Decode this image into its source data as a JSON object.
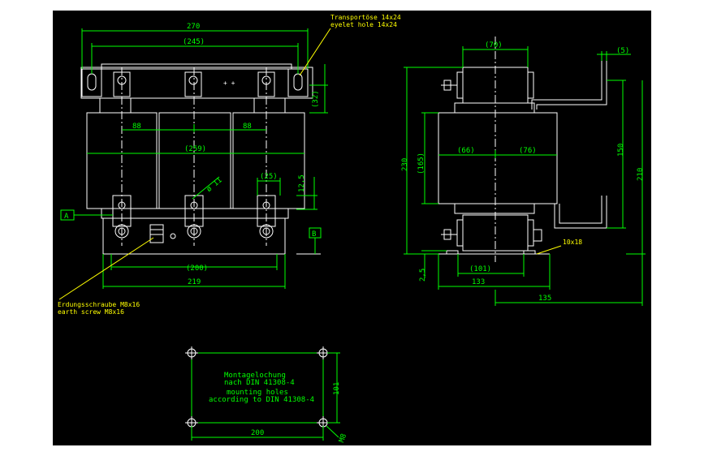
{
  "colors": {
    "line": "#ffffff",
    "dimension": "#00ff00",
    "note": "#ffff00",
    "background": "#000000"
  },
  "front_view": {
    "dims": {
      "overall_width": "270",
      "hole_spacing": "(245)",
      "core_width": "(259)",
      "pitch_left": "88",
      "pitch_right": "88",
      "mount_inner": "(200)",
      "mount_outer": "219",
      "terminal_width": "(25)",
      "terminal_height": "12,5",
      "eyelet_height": "(32)",
      "diameter": "ø 11"
    },
    "eyelet_note_de": "Transportöse 14x24",
    "eyelet_note_en": "eyelet hole 14x24",
    "earth_note_de": "Erdungsschraube M8x16",
    "earth_note_en": "earth screw M8x16",
    "datum_a": "A",
    "datum_b": "B",
    "terminal_marks": "+ +"
  },
  "side_view": {
    "dims": {
      "top_width": "(70)",
      "lug": "(5)",
      "total_height": "230",
      "core_height": "(165)",
      "left_half": "(66)",
      "right_half": "(76)",
      "height_150": "150",
      "height_210": "210",
      "base_offset": "2,5",
      "foot_inner": "(101)",
      "foot_outer": "133",
      "overall_depth": "135"
    },
    "slot_note": "10x18"
  },
  "mounting": {
    "title_de_1": "Montagelochung",
    "title_de_2": "nach DIN 41308-4",
    "title_en_1": "mounting holes",
    "title_en_2": "according to DIN 41308-4",
    "width": "200",
    "height": "101",
    "bolt": "M8"
  }
}
